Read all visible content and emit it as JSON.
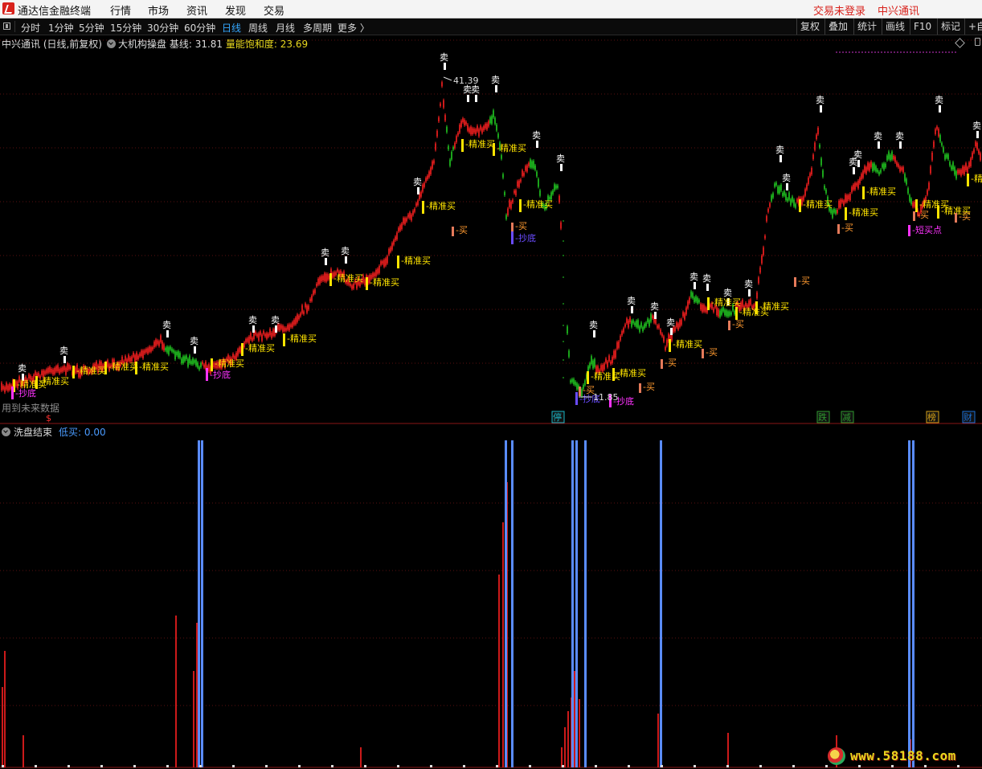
{
  "app": {
    "title": "通达信金融终端",
    "menu": [
      "行情",
      "市场",
      "资讯",
      "发现",
      "交易"
    ],
    "login_status": "交易未登录",
    "broker": "中兴通讯"
  },
  "toolbar": {
    "periods": [
      "分时",
      "1分钟",
      "5分钟",
      "15分钟",
      "30分钟",
      "60分钟",
      "日线",
      "周线",
      "月线",
      "多周期",
      "更多 〉"
    ],
    "active_period": "日线",
    "right_buttons": [
      "复权",
      "叠加",
      "统计",
      "画线",
      "F10",
      "标记",
      "+自"
    ]
  },
  "main_chart": {
    "stock_title": "中兴通讯 (日线,前复权)",
    "indicator_name": "大机构操盘",
    "baseline_label": "基线: 31.81",
    "energy_label": "量能饱和度: 23.69",
    "high_label": "41.39",
    "low_label": "11.85",
    "future_data_note": "用到未来数据",
    "colors": {
      "up": "#ff2020",
      "down": "#22cc22",
      "buy_signal": "#ffe400",
      "sell_signal": "#ffffff",
      "bottom_signal": "#ff33ff"
    }
  },
  "event_markers": [
    {
      "label": "停",
      "color": "#1ab7c6"
    },
    {
      "label": "跌",
      "color": "#2f9a2f"
    },
    {
      "label": "减",
      "color": "#2f9a2f"
    },
    {
      "label": "榜",
      "color": "#d4a017"
    },
    {
      "label": "财",
      "color": "#1a6fd8"
    }
  ],
  "signal_labels": {
    "sell": "卖",
    "precise_buy": "精准买",
    "buy": "买",
    "bottom": "抄底",
    "short_buy": "短买点"
  },
  "sub_chart": {
    "indicator_name": "洗盘结束",
    "low_buy_label": "低买: 0.00",
    "colors": {
      "bar": "#cc1a1a",
      "signal": "#5a8cff"
    }
  },
  "watermark": {
    "text": "www.58188.com"
  }
}
